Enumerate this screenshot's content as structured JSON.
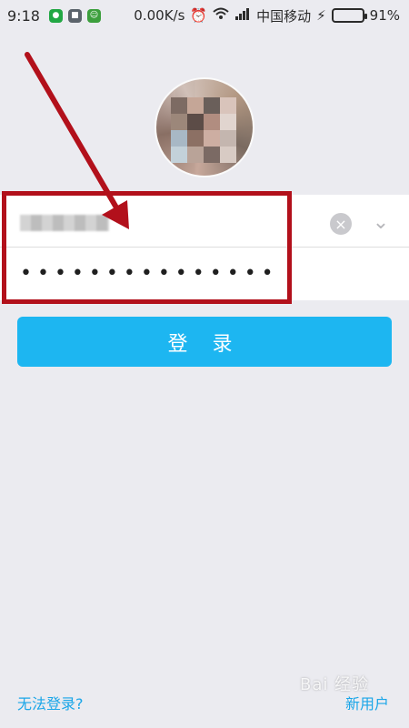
{
  "status_bar": {
    "time": "9:18",
    "net_speed": "0.00K/s",
    "carrier": "中国移动",
    "battery": "91%",
    "battery_level": 0.91,
    "icons": [
      "app-icon-1",
      "app-icon-2",
      "app-icon-3",
      "alarm-icon",
      "wifi-icon",
      "signal-icon",
      "charging-icon",
      "battery-icon"
    ]
  },
  "login": {
    "password_mask": "•••••••••••••••",
    "login_label": "登 录",
    "forgot_label": "无法登录?",
    "new_user_label": "新用户"
  },
  "colors": {
    "accent": "#1db6f1",
    "background": "#ebebf0",
    "highlight": "#b2101b",
    "link": "#1aa6e8"
  },
  "overlay": {
    "watermark": "Bai 经验"
  }
}
